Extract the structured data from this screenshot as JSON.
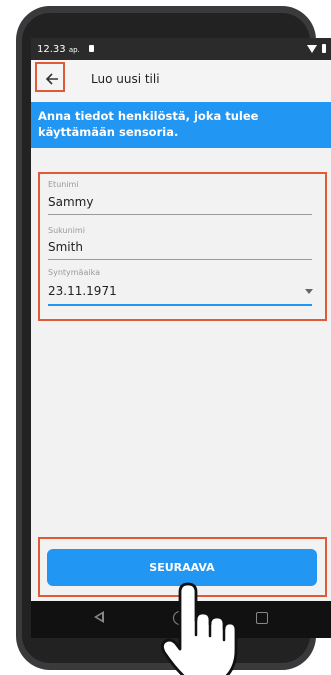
{
  "status_bar": {
    "time": "12.33",
    "ampm": "ap."
  },
  "app_bar": {
    "back_icon": "arrow-left-icon",
    "title": "Luo uusi tili"
  },
  "banner": {
    "text": "Anna tiedot henkilöstä, joka tulee käyttämään sensoria."
  },
  "form": {
    "first_name": {
      "label": "Etunimi",
      "value": "Sammy"
    },
    "last_name": {
      "label": "Sukunimi",
      "value": "Smith"
    },
    "birth_date": {
      "label": "Syntymäaika",
      "value": "23.11.1971"
    }
  },
  "actions": {
    "next_label": "SEURAAVA"
  },
  "colors": {
    "accent": "#2196f3",
    "highlight": "#e05a3a"
  },
  "nav_bar": {
    "icons": [
      "back-triangle-icon",
      "home-circle-icon",
      "recents-square-icon"
    ]
  }
}
